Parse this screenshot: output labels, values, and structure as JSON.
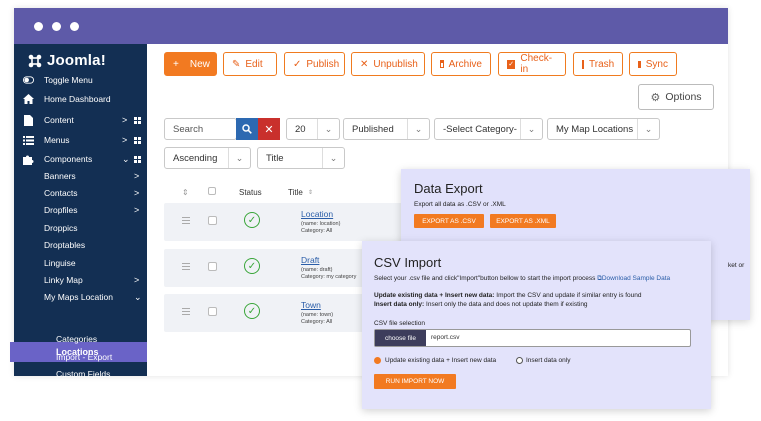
{
  "app": {
    "brand": "Joomla!"
  },
  "sidebar": {
    "items": [
      {
        "label": "Toggle Menu",
        "icon": "toggle-icon"
      },
      {
        "label": "Home Dashboard",
        "icon": "home-icon"
      },
      {
        "label": "Content",
        "icon": "file-icon",
        "chevron": ">"
      },
      {
        "label": "Menus",
        "icon": "list-icon",
        "chevron": ">"
      },
      {
        "label": "Components",
        "icon": "puzzle-icon",
        "chevron": "v"
      }
    ],
    "subitems": [
      "Banners",
      "Contacts",
      "Dropfiles",
      "Droppics",
      "Droptables",
      "Linguise",
      "Linky Map",
      "My Maps Location"
    ],
    "active_item": "Locations",
    "children": [
      "Categories",
      "Import - Export",
      "Custom Fields"
    ],
    "subitem_chevrons": [
      "Banners",
      "Contacts",
      "Dropfiles",
      "Linky Map",
      "My Maps Location"
    ]
  },
  "toolbar": {
    "new": "New",
    "edit": "Edit",
    "publish": "Publish",
    "unpublish": "Unpublish",
    "archive": "Archive",
    "checkin": "Check-in",
    "trash": "Trash",
    "sync": "Sync",
    "options": "Options"
  },
  "filters": {
    "search_placeholder": "Search",
    "limit": "20",
    "state": "Published",
    "category": "-Select Category-",
    "map": "My Map Locations",
    "order_dir": "Ascending",
    "order_field": "Title"
  },
  "table": {
    "headers": {
      "status": "Status",
      "title": "Title"
    },
    "rows": [
      {
        "title": "Location",
        "name": "(name: location)",
        "category": "Category: All"
      },
      {
        "title": "Draft",
        "name": "(name: draft)",
        "category": "Category: my category"
      },
      {
        "title": "Town",
        "name": "(name: town)",
        "category": "Category: All"
      }
    ]
  },
  "export_panel": {
    "title": "Data Export",
    "desc": "Export all data as .CSV or .XML",
    "btn_csv": "EXPORT AS .CSV",
    "btn_xml": "EXPORT AS .XML",
    "cut_text": "ket or"
  },
  "import_panel": {
    "title": "CSV Import",
    "desc": "Select your .csv file and click\"Import\"button bellow to start the import process",
    "sample_link": "Download Sample Data",
    "opt1_bold": "Update existing data + Insert new data:",
    "opt1_text": " Import the CSV and update if similar entry is found",
    "opt2_bold": "Insert data only:",
    "opt2_text": " Insert only the data and does not update them if existing",
    "file_label": "CSV file selection",
    "choose_btn": "choose file",
    "file_name": "report.csv",
    "radio1": "Update existing data + Insert new data",
    "radio2": "Insert data only",
    "run_btn": "RUN IMPORT NOW"
  },
  "colors": {
    "accent": "#f27a21",
    "sidebar": "#132f53",
    "titlebar": "#5e5aa8",
    "active": "#6a63c7",
    "panel": "#e1e1fb"
  }
}
